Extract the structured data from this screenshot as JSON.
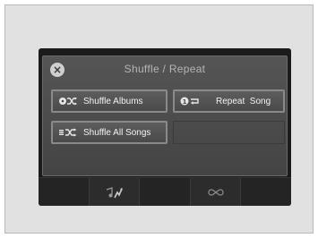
{
  "dialog": {
    "title": "Shuffle / Repeat",
    "close_icon": "close-icon"
  },
  "options": [
    {
      "label": "Shuffle Albums",
      "icon": "shuffle-albums-icon"
    },
    {
      "label": "Repeat  Song",
      "icon": "repeat-one-icon"
    },
    {
      "label": "Shuffle All Songs",
      "icon": "shuffle-all-icon"
    }
  ],
  "bottom_bar": {
    "icons": [
      "music-search-icon",
      "shuffle-repeat-icon"
    ]
  },
  "colors": {
    "screen_bg": "#1b1b1b",
    "dialog_bg": "#4a4a4a",
    "button_border": "#8a8a8a",
    "text": "#f2f2f2",
    "frame_bg": "#e1e1e1"
  }
}
